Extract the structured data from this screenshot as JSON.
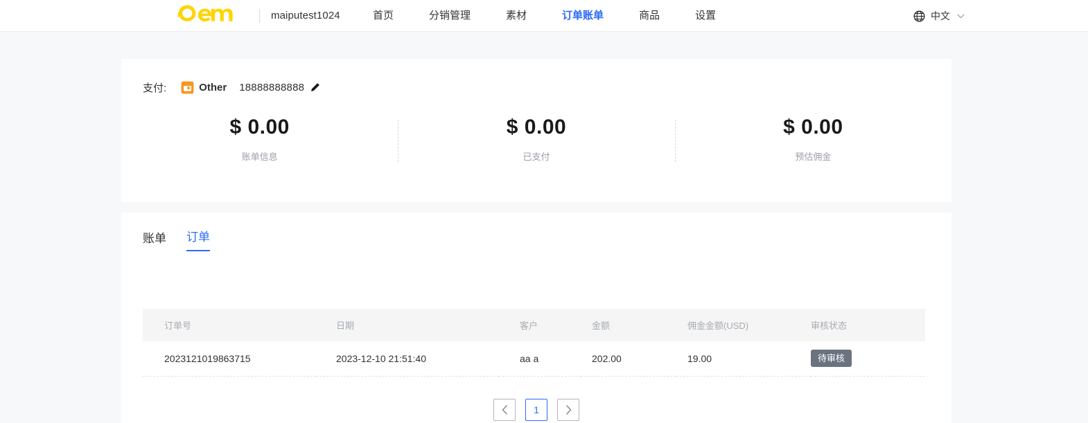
{
  "header": {
    "logo_alt": "oem-logo",
    "brand_name": "maiputest1024",
    "nav_items": [
      {
        "label": "首页",
        "active": false
      },
      {
        "label": "分销管理",
        "active": false
      },
      {
        "label": "素材",
        "active": false
      },
      {
        "label": "订单账单",
        "active": true
      },
      {
        "label": "商品",
        "active": false
      },
      {
        "label": "设置",
        "active": false
      }
    ],
    "language": {
      "label": "中文",
      "icon": "globe-icon",
      "chevron": "chevron-down-icon"
    }
  },
  "summary": {
    "pay_label": "支付:",
    "method_icon": "wallet-icon",
    "method_name": "Other",
    "phone": "18888888888",
    "edit_icon": "pencil-icon",
    "stats": [
      {
        "value": "$ 0.00",
        "label": "账单信息"
      },
      {
        "value": "$ 0.00",
        "label": "已支付"
      },
      {
        "value": "$ 0.00",
        "label": "预估佣金"
      }
    ]
  },
  "orders": {
    "tabs": [
      {
        "label": "账单",
        "active": false
      },
      {
        "label": "订单",
        "active": true
      }
    ],
    "columns": [
      "订单号",
      "日期",
      "客户",
      "金额",
      "佣金金额(USD)",
      "审核状态"
    ],
    "rows": [
      {
        "order_no": "2023121019863715",
        "date": "2023-12-10 21:51:40",
        "customer": "aa a",
        "amount": "202.00",
        "commission": "19.00",
        "status": "待审核"
      }
    ],
    "pagination": {
      "prev": "prev-page",
      "current": "1",
      "next": "next-page"
    }
  },
  "colors": {
    "accent": "#2b6cf6",
    "logo": "#ffd400",
    "badge": "#6b7280",
    "page_bg": "#f7f8fa"
  }
}
